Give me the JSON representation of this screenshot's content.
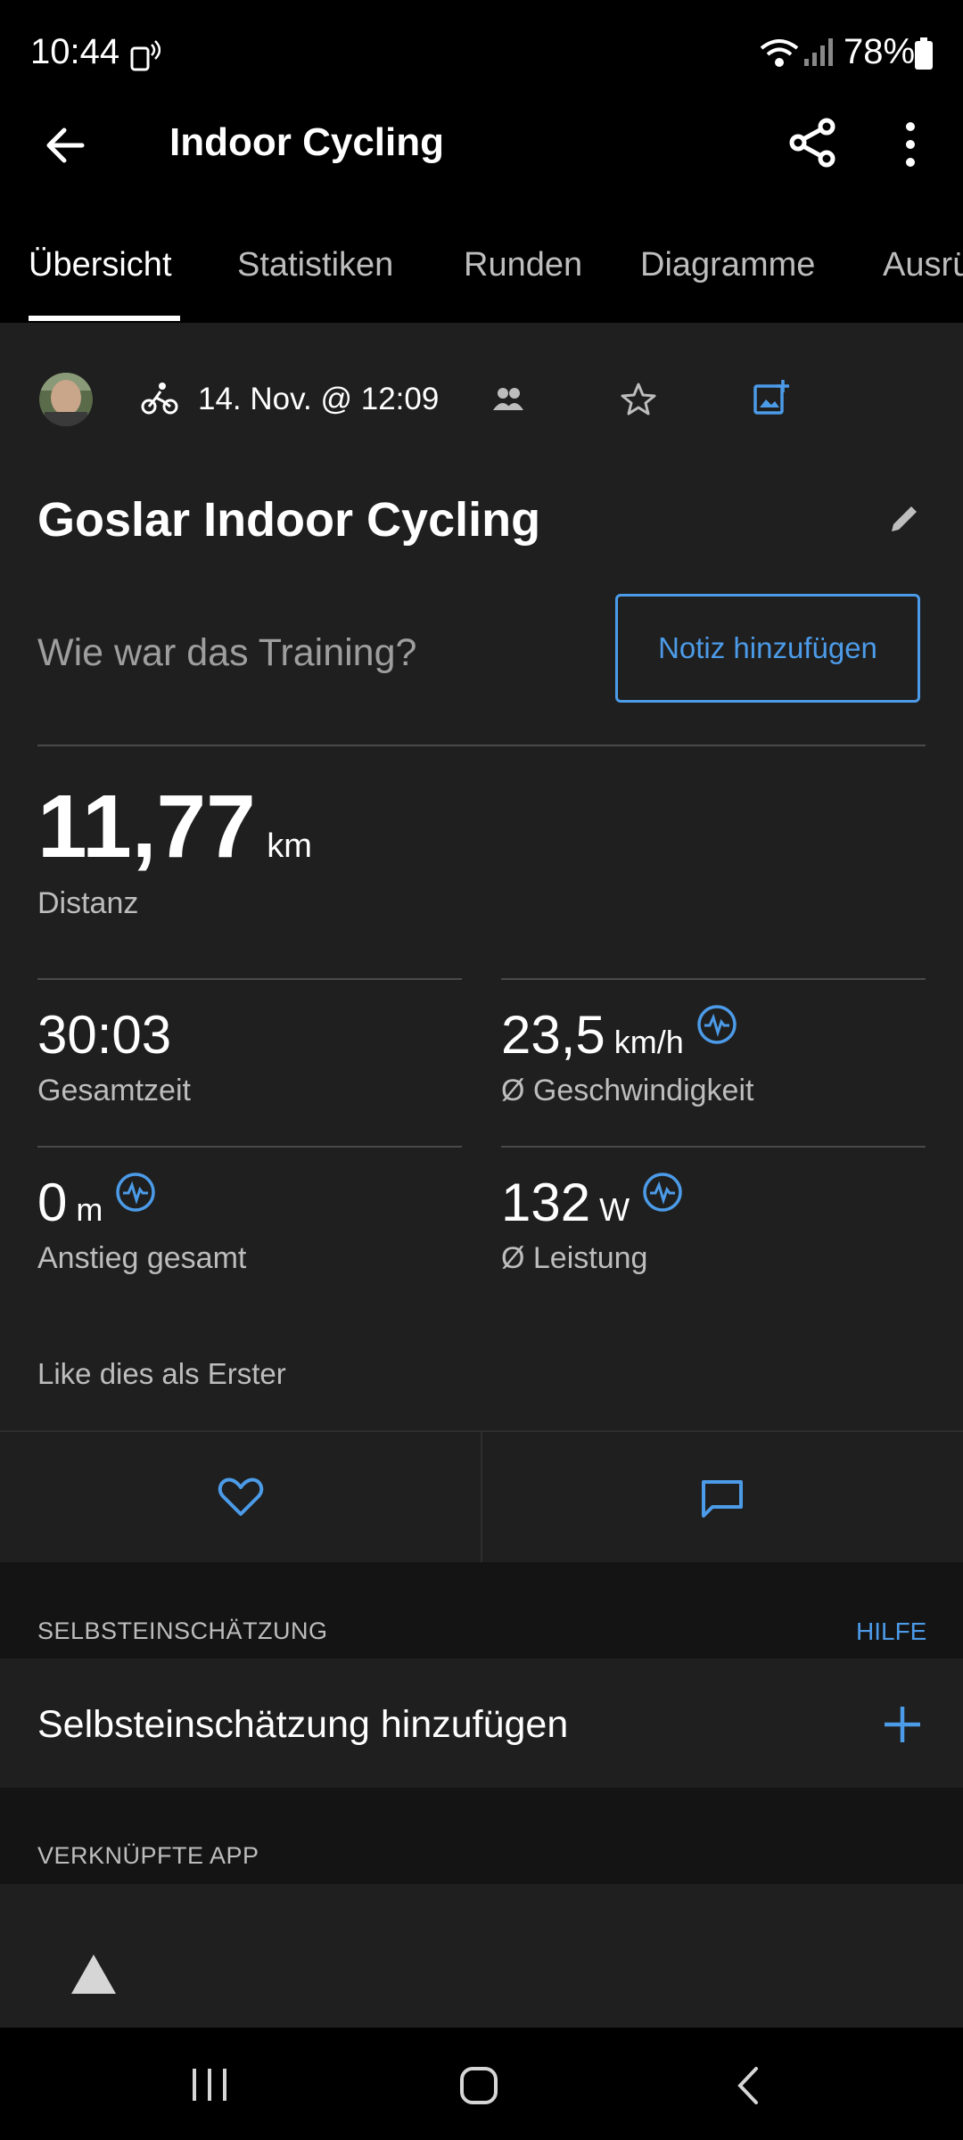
{
  "status_bar": {
    "time": "10:44",
    "battery": "78%"
  },
  "app_bar": {
    "title": "Indoor Cycling"
  },
  "tabs": [
    {
      "label": "Übersicht"
    },
    {
      "label": "Statistiken"
    },
    {
      "label": "Runden"
    },
    {
      "label": "Diagramme"
    },
    {
      "label": "Ausrü"
    }
  ],
  "activity": {
    "date": "14. Nov. @ 12:09",
    "name": "Goslar Indoor Cycling",
    "note_prompt": "Wie war das Training?",
    "note_button": "Notiz hinzufügen"
  },
  "primary_stat": {
    "value": "11,77",
    "unit": "km",
    "label": "Distanz"
  },
  "stats": [
    {
      "value": "30:03",
      "unit": "",
      "label": "Gesamtzeit"
    },
    {
      "value": "23,5",
      "unit": "km/h",
      "label": "Ø Geschwindigkeit"
    },
    {
      "value": "0",
      "unit": "m",
      "label": "Anstieg gesamt"
    },
    {
      "value": "132",
      "unit": "W",
      "label": "Ø Leistung"
    }
  ],
  "social": {
    "like_text": "Like dies als Erster"
  },
  "self_eval": {
    "caption": "SELBSTEINSCHÄTZUNG",
    "help": "HILFE",
    "add_label": "Selbsteinschätzung hinzufügen"
  },
  "linked_app": {
    "caption": "VERKNÜPFTE APP"
  },
  "colors": {
    "accent": "#4c9be8",
    "background": "#1f1f1f",
    "bar": "#000000"
  }
}
